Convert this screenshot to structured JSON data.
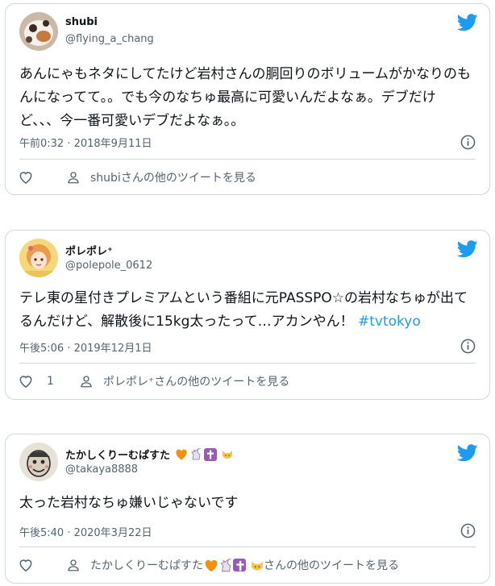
{
  "tweets": [
    {
      "name": "shubi",
      "handle": "@flying_a_chang",
      "text": "あんにゃもネタにしてたけど岩村さんの胴回りのボリュームがかなりのもんになってて。。でも今のなちゅ最高に可愛いんだよなぁ。デブだけど、、、今一番可愛いデブだよなぁ。。",
      "timestamp": "午前0:32 · 2018年9月11日",
      "likes": "",
      "profile_link": "shubiさんの他のツイートを見る"
    },
    {
      "name": "ポレポレ⁺",
      "handle": "@polepole_0612",
      "text": "テレ東の星付きプレミアムという番組に元PASSPO☆の岩村なちゅが出てるんだけど、解散後に15kg太ったって…アカンやん！",
      "hashtag": "#tvtokyo",
      "timestamp": "午後5:06 · 2019年12月1日",
      "likes": "1",
      "profile_link": "ポレポレ⁺さんの他のツイートを見る"
    },
    {
      "name": "たかしくりーむぱすた",
      "handle": "@takaya8888",
      "text": "太った岩村なちゅ嫌いじゃないです",
      "timestamp": "午後5:40 · 2020年3月22日",
      "likes": "",
      "profile_link_prefix": "たかしくりーむぱすた",
      "profile_link_suffix": "さんの他のツイートを見る"
    }
  ],
  "colors": {
    "twitter_blue": "#1d9bf0",
    "hashtag": "#1d9bf0",
    "secondary_text": "#536471",
    "border": "#cfd9de"
  },
  "icons": [
    "twitter-bird-icon",
    "info-icon",
    "heart-icon",
    "person-icon"
  ]
}
